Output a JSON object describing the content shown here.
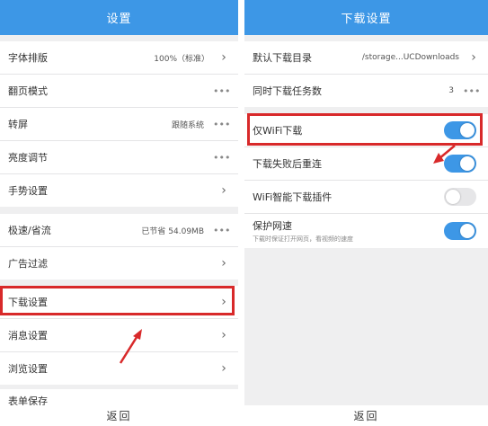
{
  "left": {
    "header_title": "设置",
    "rows": {
      "font": {
        "label": "字体排版",
        "value": "100%（标准）"
      },
      "page_mode": {
        "label": "翻页模式"
      },
      "skin": {
        "label": "转屏",
        "value": "跟随系统"
      },
      "brightness": {
        "label": "亮度调节"
      },
      "gesture": {
        "label": "手势设置"
      },
      "speed": {
        "label": "极速/省流",
        "value": "已节省 54.09MB"
      },
      "ad_filter": {
        "label": "广告过滤"
      },
      "download": {
        "label": "下载设置"
      },
      "message": {
        "label": "消息设置"
      },
      "browse": {
        "label": "浏览设置"
      },
      "form_save": {
        "label": "表单保存"
      }
    },
    "back_label": "返回"
  },
  "right": {
    "header_title": "下载设置",
    "rows": {
      "directory": {
        "label": "默认下载目录",
        "value": "/storage...UCDownloads"
      },
      "concurrent": {
        "label": "同时下载任务数",
        "value": "3"
      },
      "wifi_only": {
        "label": "仅WiFi下载",
        "toggle": true
      },
      "retry": {
        "label": "下载失败后重连",
        "toggle": true
      },
      "wifi_plugin": {
        "label": "WiFi智能下载插件",
        "toggle": false
      },
      "protect": {
        "label": "保护网速",
        "sublabel": "下载时保证打开网页，看视频的速度",
        "toggle": true
      }
    },
    "back_label": "返回"
  },
  "colors": {
    "accent": "#3d97e6",
    "highlight": "#d8292a"
  },
  "icons": {
    "chevron": "chevron-right-icon",
    "more": "more-dots-icon"
  }
}
